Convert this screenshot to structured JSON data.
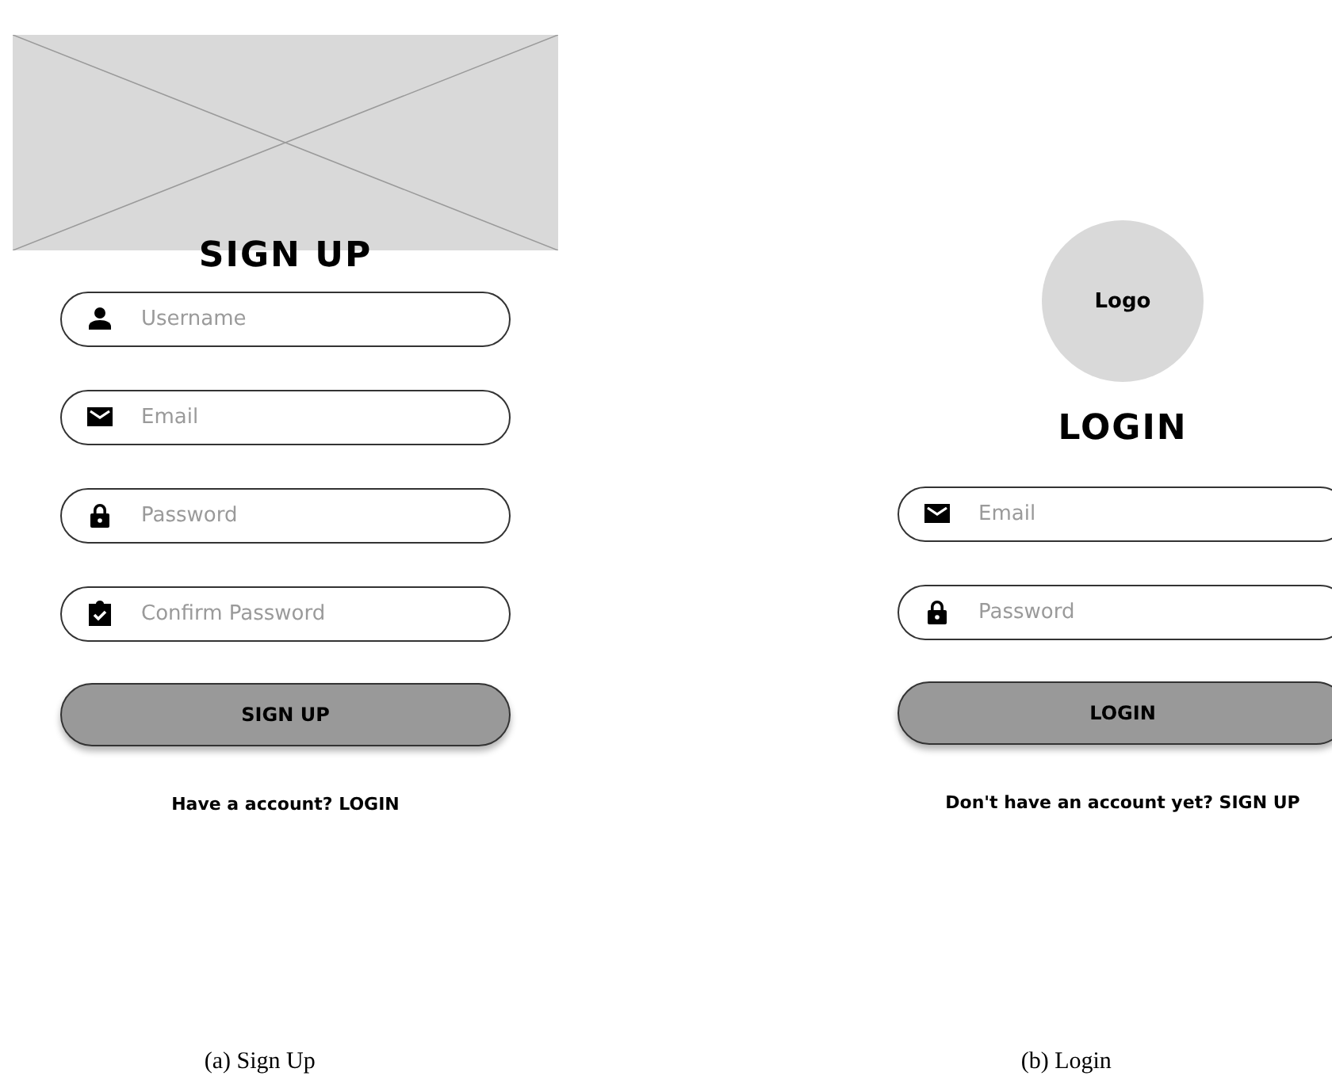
{
  "screens": [
    {
      "kind": "signup",
      "title": "SIGN UP",
      "fields": [
        {
          "kind": "username",
          "placeholder": "Username"
        },
        {
          "kind": "email",
          "placeholder": "Email"
        },
        {
          "kind": "password",
          "placeholder": "Password"
        },
        {
          "kind": "confirm",
          "placeholder": "Confirm Password"
        }
      ],
      "button": "SIGN UP",
      "footer": "Have a account? LOGIN",
      "caption": "(a) Sign Up"
    },
    {
      "kind": "login",
      "logo": "Logo",
      "title": "LOGIN",
      "fields": [
        {
          "kind": "email",
          "placeholder": "Email"
        },
        {
          "kind": "password",
          "placeholder": "Password"
        }
      ],
      "button": "LOGIN",
      "footer": "Don't have an account yet? SIGN UP",
      "caption": "(b) Login"
    }
  ]
}
